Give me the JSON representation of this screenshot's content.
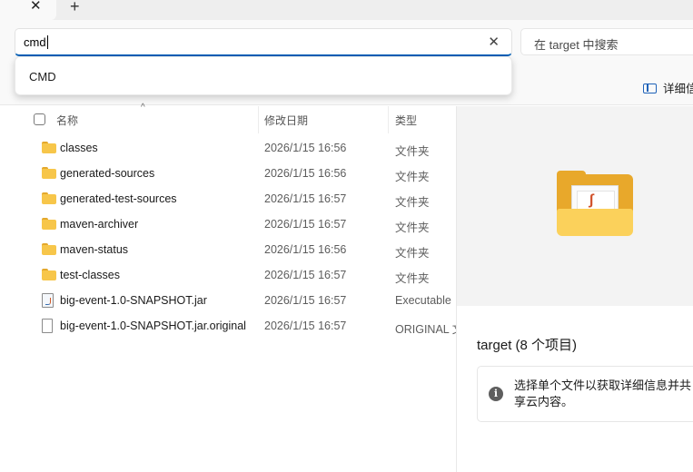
{
  "titlebar": {
    "close_tab": "✕",
    "new_tab": "+"
  },
  "address": {
    "value": "cmd",
    "clear": "✕"
  },
  "search": {
    "placeholder": "在 target 中搜索"
  },
  "toolbar": {
    "details_label": "详细信"
  },
  "dropdown": {
    "items": [
      "CMD"
    ]
  },
  "columns": {
    "name": "名称",
    "date": "修改日期",
    "type": "类型",
    "sort_indicator": "^"
  },
  "files": [
    {
      "name": "classes",
      "date": "2026/1/15 16:56",
      "type": "文件夹",
      "icon": "folder-icon"
    },
    {
      "name": "generated-sources",
      "date": "2026/1/15 16:56",
      "type": "文件夹",
      "icon": "folder-icon"
    },
    {
      "name": "generated-test-sources",
      "date": "2026/1/15 16:57",
      "type": "文件夹",
      "icon": "folder-icon"
    },
    {
      "name": "maven-archiver",
      "date": "2026/1/15 16:57",
      "type": "文件夹",
      "icon": "folder-icon"
    },
    {
      "name": "maven-status",
      "date": "2026/1/15 16:56",
      "type": "文件夹",
      "icon": "folder-icon"
    },
    {
      "name": "test-classes",
      "date": "2026/1/15 16:57",
      "type": "文件夹",
      "icon": "folder-icon"
    },
    {
      "name": "big-event-1.0-SNAPSHOT.jar",
      "date": "2026/1/15 16:57",
      "type": "Executable",
      "icon": "jar-file-icon"
    },
    {
      "name": "big-event-1.0-SNAPSHOT.jar.original",
      "date": "2026/1/15 16:57",
      "type": "ORIGINAL 文",
      "icon": "file-icon"
    }
  ],
  "details": {
    "title": "target (8 个项目)",
    "message": "选择单个文件以获取详细信息并共享云内容。",
    "info_glyph": "i"
  },
  "colors": {
    "accent": "#005fb8",
    "folder": "#f7c64a"
  }
}
